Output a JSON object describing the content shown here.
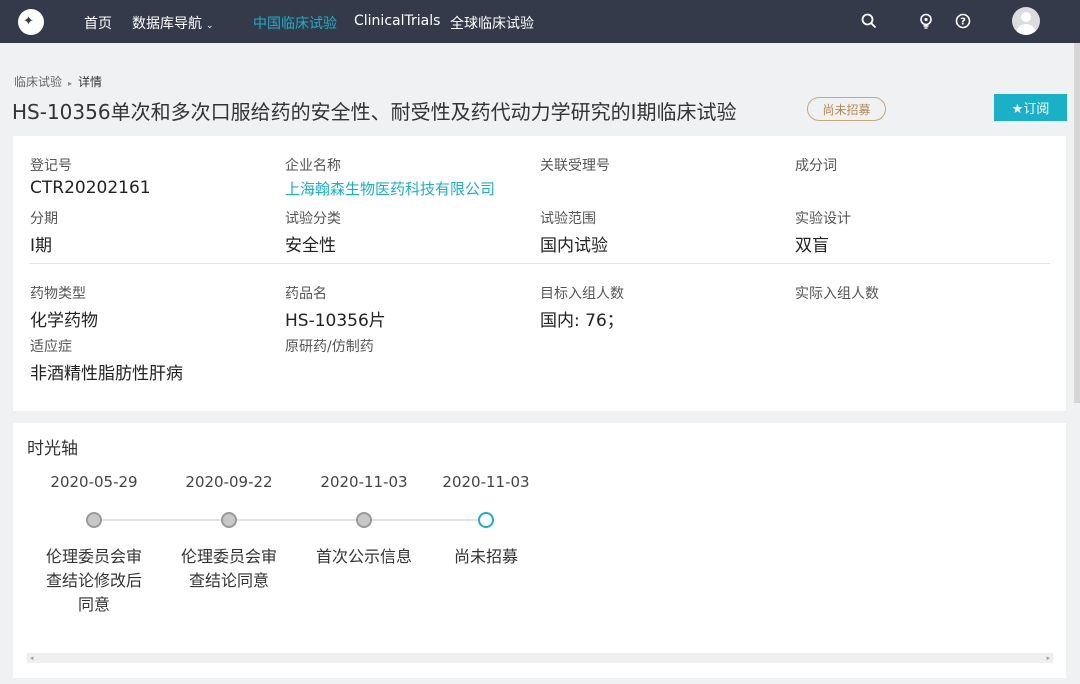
{
  "nav": {
    "logo_icon": "logo-icon",
    "items": [
      {
        "label": "首页"
      },
      {
        "label": "数据库导航",
        "caret": "⌄"
      },
      {
        "label": "中国临床试验"
      },
      {
        "label": "ClinicalTrials"
      },
      {
        "label": "全球临床试验"
      }
    ],
    "active_index": 2,
    "right_icons": [
      "search-icon",
      "bulb-icon",
      "help-icon",
      "avatar"
    ]
  },
  "breadcrumb": {
    "parent": "临床试验",
    "separator": "▸",
    "current": "详情"
  },
  "title": "HS-10356单次和多次口服给药的安全性、耐受性及药代动力学研究的I期临床试验",
  "status_badge": "尚未招募",
  "subscribe_label": "★订阅",
  "info": {
    "reg_no_label": "登记号",
    "reg_no": "CTR20202161",
    "company_label": "企业名称",
    "company": "上海翰森生物医药科技有限公司",
    "accept_no_label": "关联受理号",
    "accept_no": "",
    "ingredient_label": "成分词",
    "ingredient": "",
    "phase_label": "分期",
    "phase": "I期",
    "category_label": "试验分类",
    "category": "安全性",
    "scope_label": "试验范围",
    "scope": "国内试验",
    "design_label": "实验设计",
    "design": "双盲",
    "drug_type_label": "药物类型",
    "drug_type": "化学药物",
    "drug_name_label": "药品名",
    "drug_name": "HS-10356片",
    "target_enroll_label": "目标入组人数",
    "target_enroll": "国内: 76；",
    "actual_enroll_label": "实际入组人数",
    "actual_enroll": "",
    "indication_label": "适应症",
    "indication": "非酒精性脂肪性肝病",
    "origin_label": "原研药/仿制药",
    "origin": ""
  },
  "timeline": {
    "title": "时光轴",
    "events": [
      {
        "date": "2020-05-29",
        "event": "伦理委员会审查结论修改后同意"
      },
      {
        "date": "2020-09-22",
        "event": "伦理委员会审查结论同意"
      },
      {
        "date": "2020-11-03",
        "event": "首次公示信息"
      },
      {
        "date": "2020-11-03",
        "event": "尚未招募"
      }
    ],
    "current_index": 3
  },
  "colors": {
    "topbar": "#343a4a",
    "accent": "#1ab0c8",
    "badge": "#b28a55"
  }
}
